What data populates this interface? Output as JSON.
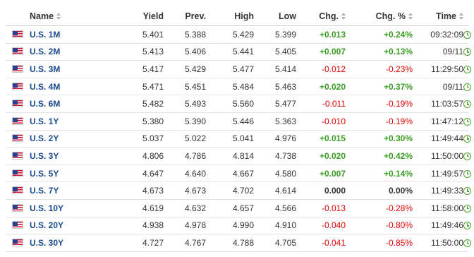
{
  "table": {
    "headers": {
      "name": "Name",
      "yield": "Yield",
      "prev": "Prev.",
      "high": "High",
      "low": "Low",
      "chg": "Chg.",
      "chg_pct": "Chg. %",
      "time": "Time"
    },
    "rows": [
      {
        "name": "U.S. 1M",
        "yield": "5.401",
        "prev": "5.388",
        "high": "5.429",
        "low": "5.399",
        "chg": "+0.013",
        "chg_pct": "+0.24%",
        "time": "09:32:09",
        "direction": "up"
      },
      {
        "name": "U.S. 2M",
        "yield": "5.413",
        "prev": "5.406",
        "high": "5.441",
        "low": "5.405",
        "chg": "+0.007",
        "chg_pct": "+0.13%",
        "time": "09/11",
        "direction": "up"
      },
      {
        "name": "U.S. 3M",
        "yield": "5.417",
        "prev": "5.429",
        "high": "5.477",
        "low": "5.414",
        "chg": "-0.012",
        "chg_pct": "-0.23%",
        "time": "11:29:50",
        "direction": "down"
      },
      {
        "name": "U.S. 4M",
        "yield": "5.471",
        "prev": "5.451",
        "high": "5.484",
        "low": "5.463",
        "chg": "+0.020",
        "chg_pct": "+0.37%",
        "time": "09/11",
        "direction": "up"
      },
      {
        "name": "U.S. 6M",
        "yield": "5.482",
        "prev": "5.493",
        "high": "5.560",
        "low": "5.477",
        "chg": "-0.011",
        "chg_pct": "-0.19%",
        "time": "11:03:57",
        "direction": "down"
      },
      {
        "name": "U.S. 1Y",
        "yield": "5.380",
        "prev": "5.390",
        "high": "5.446",
        "low": "5.363",
        "chg": "-0.010",
        "chg_pct": "-0.19%",
        "time": "11:47:12",
        "direction": "down"
      },
      {
        "name": "U.S. 2Y",
        "yield": "5.037",
        "prev": "5.022",
        "high": "5.041",
        "low": "4.976",
        "chg": "+0.015",
        "chg_pct": "+0.30%",
        "time": "11:49:44",
        "direction": "up"
      },
      {
        "name": "U.S. 3Y",
        "yield": "4.806",
        "prev": "4.786",
        "high": "4.814",
        "low": "4.738",
        "chg": "+0.020",
        "chg_pct": "+0.42%",
        "time": "11:50:00",
        "direction": "up"
      },
      {
        "name": "U.S. 5Y",
        "yield": "4.647",
        "prev": "4.640",
        "high": "4.667",
        "low": "4.580",
        "chg": "+0.007",
        "chg_pct": "+0.14%",
        "time": "11:49:57",
        "direction": "up"
      },
      {
        "name": "U.S. 7Y",
        "yield": "4.673",
        "prev": "4.673",
        "high": "4.702",
        "low": "4.614",
        "chg": "0.000",
        "chg_pct": "0.00%",
        "time": "11:49:33",
        "direction": "flat"
      },
      {
        "name": "U.S. 10Y",
        "yield": "4.619",
        "prev": "4.632",
        "high": "4.657",
        "low": "4.566",
        "chg": "-0.013",
        "chg_pct": "-0.28%",
        "time": "11:58:00",
        "direction": "down"
      },
      {
        "name": "U.S. 20Y",
        "yield": "4.938",
        "prev": "4.978",
        "high": "4.990",
        "low": "4.910",
        "chg": "-0.040",
        "chg_pct": "-0.80%",
        "time": "11:49:46",
        "direction": "down"
      },
      {
        "name": "U.S. 30Y",
        "yield": "4.727",
        "prev": "4.767",
        "high": "4.788",
        "low": "4.705",
        "chg": "-0.041",
        "chg_pct": "-0.85%",
        "time": "11:50:00",
        "direction": "down"
      }
    ]
  },
  "icons": {
    "flag": "us-flag-icon",
    "sort": "sort-arrows-icon",
    "status": "clock-icon"
  },
  "colors": {
    "positive": "#3a9d23",
    "negative": "#e60000",
    "link": "#1a4a8f",
    "clock": "#49a32b"
  }
}
